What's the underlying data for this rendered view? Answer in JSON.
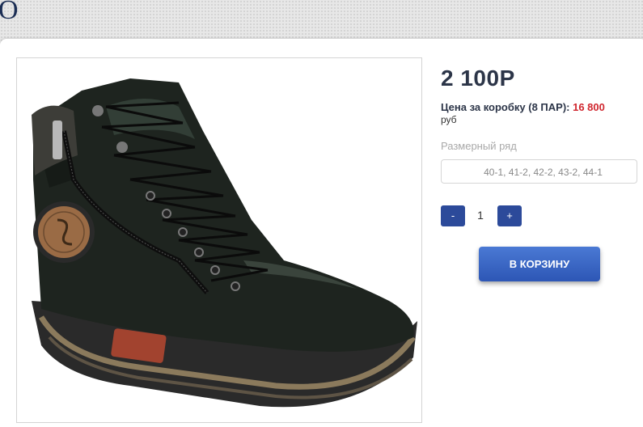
{
  "header": {
    "logo_fragment": "O"
  },
  "product": {
    "image_alt_icon": "leather-high-top-boot",
    "price": "2 100Р",
    "box_price_label": "Цена за коробку (8 ПАР):",
    "box_price_value": "16 800",
    "currency": "руб",
    "size_label": "Размерный ряд",
    "size_value": "40-1, 41-2, 42-2, 43-2, 44-1",
    "qty_minus": "-",
    "qty_value": "1",
    "qty_plus": "+",
    "cart_button": "В КОРЗИНУ"
  },
  "colors": {
    "accent": "#2c4a9a",
    "price_red": "#d0262e",
    "text_dark": "#2c3548"
  }
}
